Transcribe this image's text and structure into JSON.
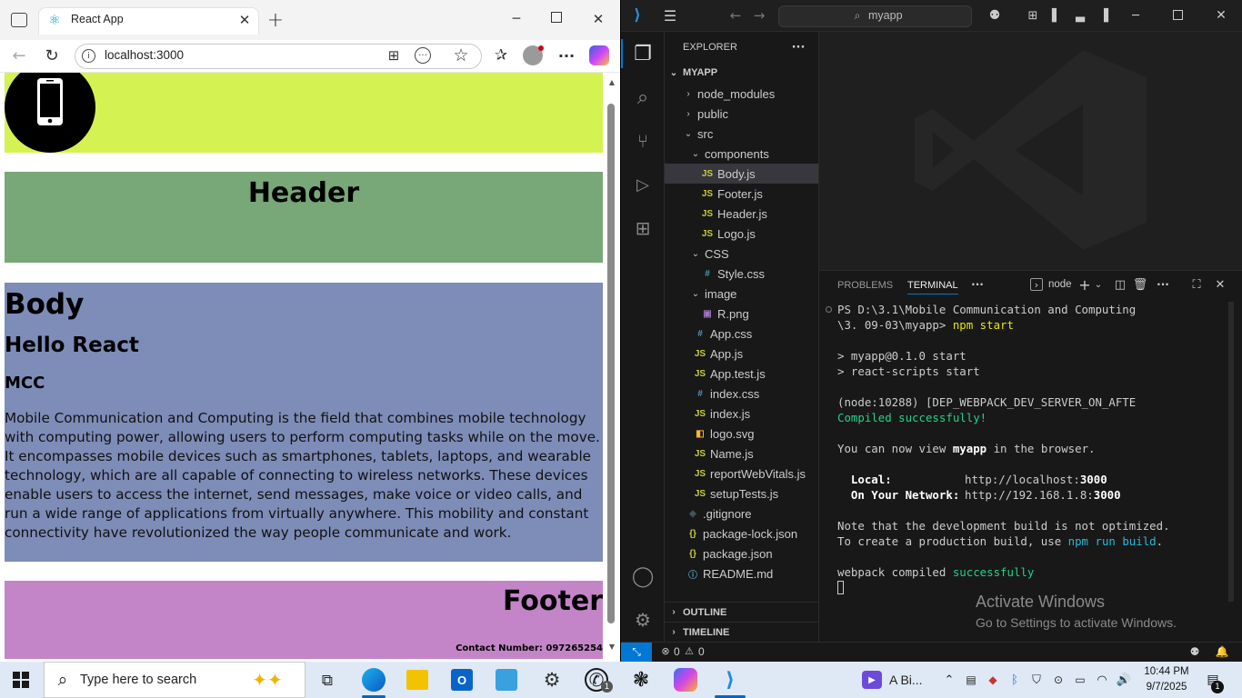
{
  "browser": {
    "tab_title": "React App",
    "address": "localhost:3000",
    "page": {
      "header_title": "Header",
      "body_title": "Body",
      "body_h2": "Hello React",
      "body_h3": "MCC",
      "body_paragraph": "Mobile Communication and Computing is the field that combines mobile technology with computing power, allowing users to perform computing tasks while on the move. It encompasses mobile devices such as smartphones, tablets, laptops, and wearable technology, which are all capable of connecting to wireless networks. These devices enable users to access the internet, send messages, make voice or video calls, and run a wide range of applications from virtually anywhere. This mobility and constant connectivity have revolutionized the way people communicate and work.",
      "footer_title": "Footer",
      "footer_contact": "Contact Number: 097265254",
      "colors": {
        "logo_bg": "#d4f252",
        "header_bg": "#78a878",
        "body_bg": "#7e8cb8",
        "footer_bg": "#c484c8"
      }
    }
  },
  "vscode": {
    "search_text": "myapp",
    "explorer_title": "EXPLORER",
    "project": "MYAPP",
    "tree": [
      {
        "label": "node_modules",
        "kind": "folder-closed",
        "depth": 1
      },
      {
        "label": "public",
        "kind": "folder-closed",
        "depth": 1
      },
      {
        "label": "src",
        "kind": "folder-open",
        "depth": 1
      },
      {
        "label": "components",
        "kind": "folder-open",
        "depth": 2
      },
      {
        "label": "Body.js",
        "kind": "js",
        "depth": 3,
        "selected": true
      },
      {
        "label": "Footer.js",
        "kind": "js",
        "depth": 3
      },
      {
        "label": "Header.js",
        "kind": "js",
        "depth": 3
      },
      {
        "label": "Logo.js",
        "kind": "js",
        "depth": 3
      },
      {
        "label": "CSS",
        "kind": "folder-open",
        "depth": 2
      },
      {
        "label": "Style.css",
        "kind": "css",
        "depth": 3
      },
      {
        "label": "image",
        "kind": "folder-open",
        "depth": 2
      },
      {
        "label": "R.png",
        "kind": "img",
        "depth": 3
      },
      {
        "label": "App.css",
        "kind": "css",
        "depth": 2
      },
      {
        "label": "App.js",
        "kind": "js",
        "depth": 2
      },
      {
        "label": "App.test.js",
        "kind": "js",
        "depth": 2
      },
      {
        "label": "index.css",
        "kind": "css",
        "depth": 2
      },
      {
        "label": "index.js",
        "kind": "js",
        "depth": 2
      },
      {
        "label": "logo.svg",
        "kind": "svg",
        "depth": 2
      },
      {
        "label": "Name.js",
        "kind": "js",
        "depth": 2
      },
      {
        "label": "reportWebVitals.js",
        "kind": "js",
        "depth": 2
      },
      {
        "label": "setupTests.js",
        "kind": "js",
        "depth": 2
      },
      {
        "label": ".gitignore",
        "kind": "git",
        "depth": 1
      },
      {
        "label": "package-lock.json",
        "kind": "json",
        "depth": 1
      },
      {
        "label": "package.json",
        "kind": "json",
        "depth": 1
      },
      {
        "label": "README.md",
        "kind": "info",
        "depth": 1
      }
    ],
    "outline": "OUTLINE",
    "timeline": "TIMELINE",
    "panel_tabs": {
      "problems": "PROBLEMS",
      "terminal": "TERMINAL"
    },
    "terminal_name": "node",
    "terminal": {
      "l1": "PS D:\\3.1\\Mobile Communication and Computing",
      "l2": "\\3. 09-03\\myapp> ",
      "l2_cmd": "npm start",
      "l3": "> myapp@0.1.0 start",
      "l4": "> react-scripts start",
      "l5": "(node:10288) [DEP_WEBPACK_DEV_SERVER_ON_AFTE",
      "l6": "Compiled successfully!",
      "l7a": "You can now view ",
      "l7b": "myapp",
      "l7c": " in the browser.",
      "local_label": "  Local:",
      "local_url": "http://localhost:",
      "local_port": "3000",
      "net_label": "  On Your Network:",
      "net_url": "http://192.168.1.8:",
      "net_port": "3000",
      "n1": "Note that the development build is not optimized.",
      "n2a": "To create a production build, use ",
      "n2b": "npm run build",
      "n2c": ".",
      "w1": "webpack compiled ",
      "w2": "successfully"
    },
    "watermark_title": "Activate Windows",
    "watermark_sub": "Go to Settings to activate Windows.",
    "status_errors": "0",
    "status_warnings": "0"
  },
  "taskbar": {
    "search_placeholder": "Type here to search",
    "widget_text": "A Bi...",
    "time": "10:44 PM",
    "date": "9/7/2025",
    "notif_count": "1",
    "whatsapp_badge": "1"
  }
}
